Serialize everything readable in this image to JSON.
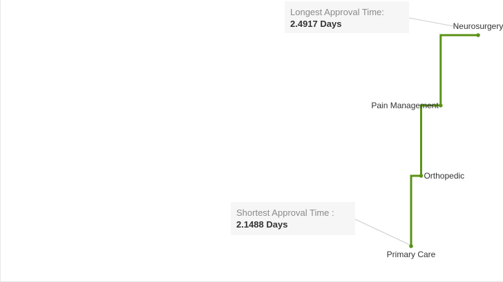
{
  "chart_data": {
    "type": "line",
    "title": "",
    "xlabel": "",
    "ylabel": "",
    "categories": [
      "Primary Care",
      "Orthopedic",
      "Pain Management",
      "Neurosurgery"
    ],
    "values": [
      2.1488,
      2.2,
      2.3,
      2.4917
    ],
    "xlim": [
      2.1488,
      2.4917
    ],
    "line_style": "step",
    "grid": false,
    "line_color": "#5a9216",
    "annotations": [
      {
        "title": "Longest Approval Time:",
        "value": "2.4917 Days",
        "target": "Neurosurgery"
      },
      {
        "title": "Shortest Approval Time :",
        "value": "2.1488 Days",
        "target": "Primary Care"
      }
    ]
  }
}
